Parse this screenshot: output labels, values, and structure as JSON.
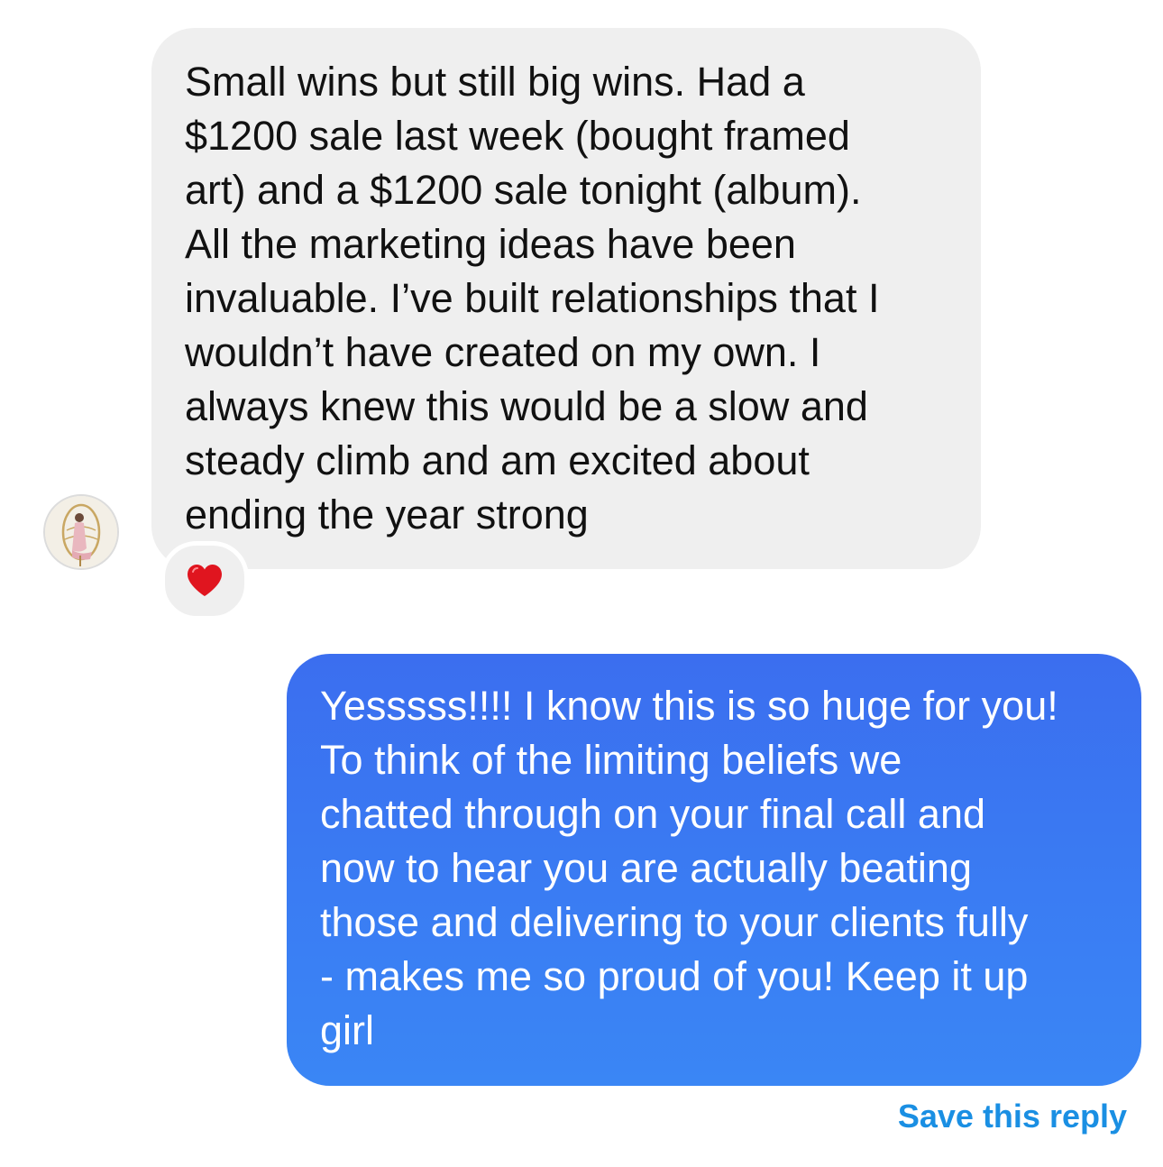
{
  "thread": {
    "incoming": {
      "lines": [
        "Small wins but still big wins. Had a",
        "$1200 sale last week (bought framed",
        "art) and a $1200 sale tonight (album).",
        "All the marketing ideas have been",
        "invaluable. I’ve built relationships that I",
        "wouldn’t have created on my own. I",
        "always knew this would be a slow and",
        "steady climb and am excited about",
        "ending the year strong"
      ],
      "avatar_icon": "user-avatar-photo",
      "reaction": "❤️",
      "reaction_icon": "red-heart-icon"
    },
    "outgoing": {
      "lines": [
        "Yesssss!!!! I know this is so huge for you!",
        "To think of the limiting beliefs we",
        "chatted through on your final call and",
        "now to hear you are actually beating",
        "those and delivering to your clients fully",
        "- makes me so proud of you! Keep it up",
        "girl"
      ]
    },
    "save_reply_label": "Save this reply"
  },
  "colors": {
    "incoming_bubble": "#efefef",
    "outgoing_bubble": "#3a7cf3",
    "link": "#1a8fe3",
    "heart": "#e0151f"
  }
}
